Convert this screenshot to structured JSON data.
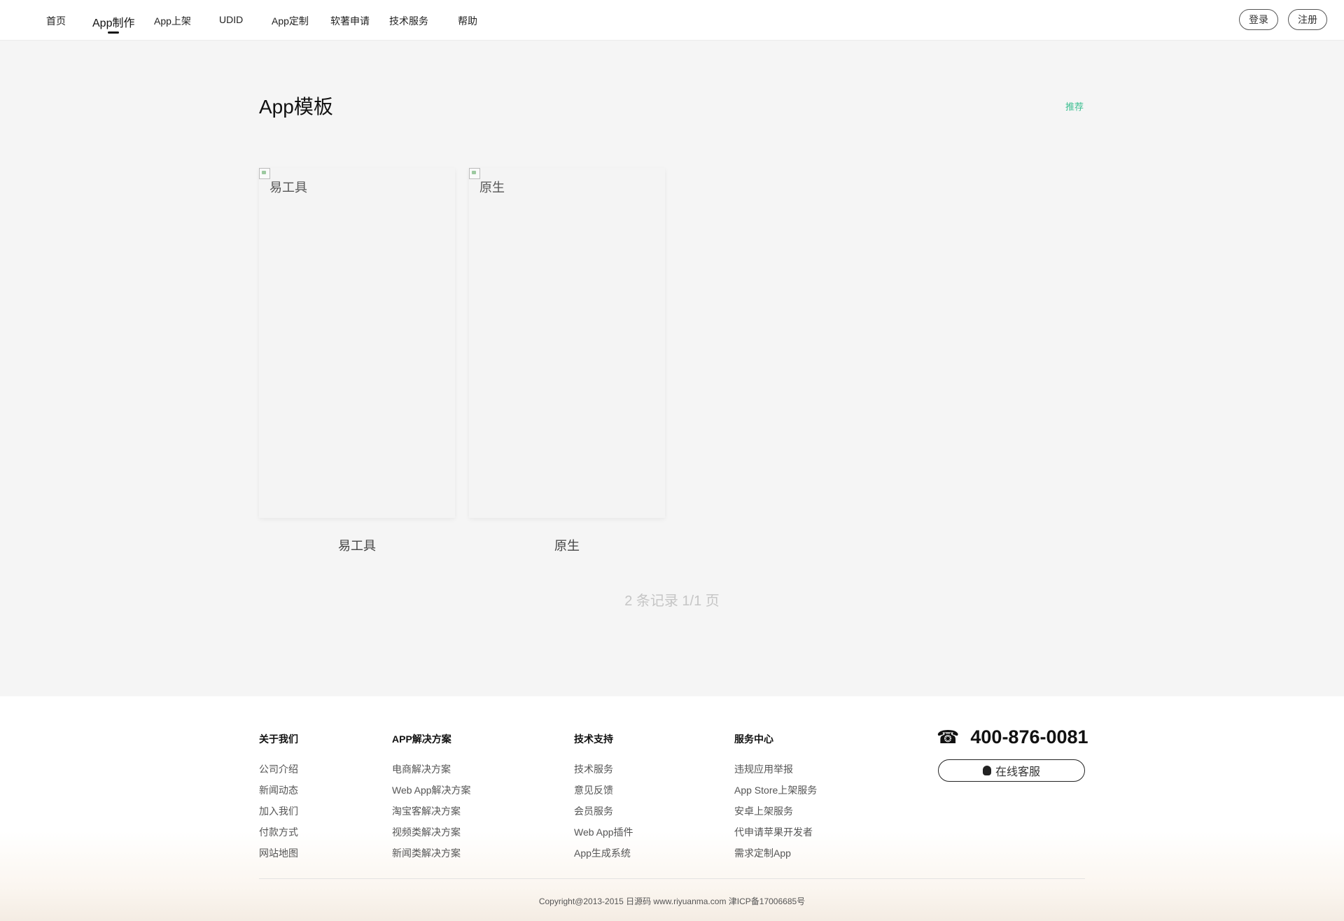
{
  "nav": {
    "items": [
      "首页",
      "App制作",
      "App上架",
      "UDID",
      "App定制",
      "软著申请",
      "技术服务",
      "帮助"
    ],
    "active_index": 1
  },
  "auth": {
    "login": "登录",
    "register": "注册"
  },
  "main": {
    "title": "App模板",
    "recommend": "推荐",
    "templates": [
      {
        "name": "易工具",
        "image_alt": "易工具"
      },
      {
        "name": "原生",
        "image_alt": "原生"
      }
    ],
    "pager": "2 条记录 1/1 页"
  },
  "footer": {
    "columns": [
      {
        "title": "关于我们",
        "links": [
          "公司介绍",
          "新闻动态",
          "加入我们",
          "付款方式",
          "网站地图"
        ]
      },
      {
        "title": "APP解决方案",
        "links": [
          "电商解决方案",
          "Web App解决方案",
          "淘宝客解决方案",
          "视频类解决方案",
          "新闻类解决方案"
        ]
      },
      {
        "title": "技术支持",
        "links": [
          "技术服务",
          "意见反馈",
          "会员服务",
          "Web App插件",
          "App生成系统"
        ]
      },
      {
        "title": "服务中心",
        "links": [
          "违规应用举报",
          "App Store上架服务",
          "安卓上架服务",
          "代申请苹果开发者",
          "需求定制App"
        ]
      }
    ],
    "phone": "400-876-0081",
    "phone_icon": "telephone-icon",
    "online_service": "在线客服",
    "online_service_icon": "qq-penguin-icon",
    "copyright": "Copyright@2013-2015 日源码 www.riyuanma.com 津ICP备17006685号"
  },
  "colors": {
    "accent": "#3cbf91",
    "background": "#f5f5f5"
  }
}
